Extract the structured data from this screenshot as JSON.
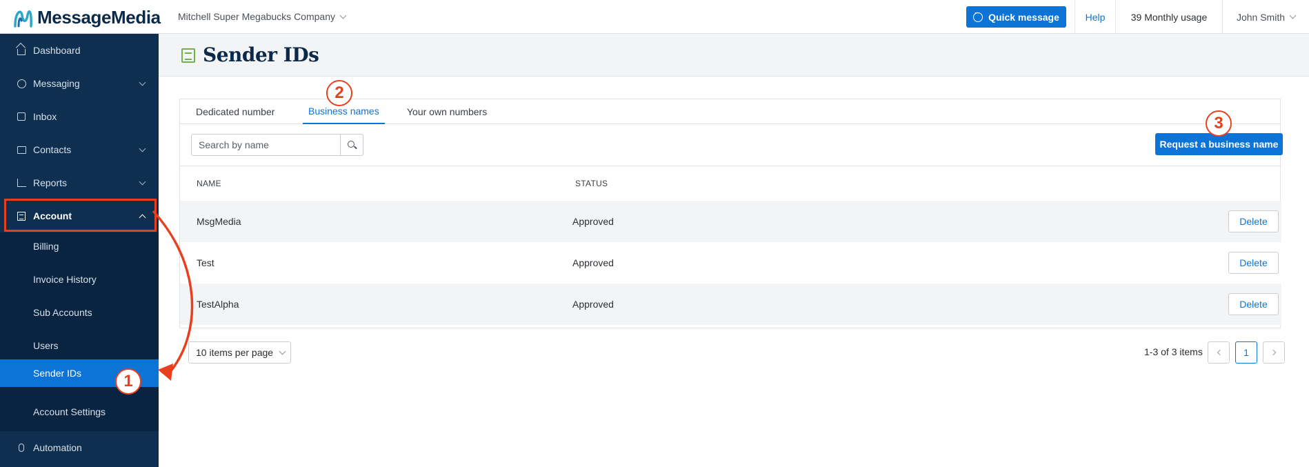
{
  "brand": {
    "name": "MessageMedia",
    "logo_icon": "messagemedia-logo-icon"
  },
  "header": {
    "company": "Mitchell Super Megabucks Company",
    "quick_message": "Quick message",
    "help": "Help",
    "usage": "39 Monthly usage",
    "user": "John Smith"
  },
  "sidebar": {
    "items": [
      {
        "label": "Dashboard",
        "icon": "home-icon"
      },
      {
        "label": "Messaging",
        "icon": "chat-bubble-icon"
      },
      {
        "label": "Inbox",
        "icon": "inbox-icon"
      },
      {
        "label": "Contacts",
        "icon": "contacts-icon"
      },
      {
        "label": "Reports",
        "icon": "chart-icon"
      },
      {
        "label": "Account",
        "icon": "account-icon"
      },
      {
        "label": "Automation",
        "icon": "automation-icon"
      }
    ],
    "account_submenu": [
      "Billing",
      "Invoice History",
      "Sub Accounts",
      "Users",
      "Sender IDs",
      "Account Settings"
    ]
  },
  "page": {
    "title": "Sender IDs"
  },
  "tabs": [
    "Dedicated number",
    "Business names",
    "Your own numbers"
  ],
  "search": {
    "placeholder": "Search by name"
  },
  "request_button": "Request a business name",
  "table": {
    "columns": [
      "NAME",
      "STATUS"
    ],
    "rows": [
      {
        "name": "MsgMedia",
        "status": "Approved",
        "action": "Delete"
      },
      {
        "name": "Test",
        "status": "Approved",
        "action": "Delete"
      },
      {
        "name": "TestAlpha",
        "status": "Approved",
        "action": "Delete"
      }
    ]
  },
  "pagination": {
    "per_page": "10 items per page",
    "range": "1-3 of 3 items",
    "current_page": "1"
  },
  "annotations": {
    "step1": "1",
    "step2": "2",
    "step3": "3"
  },
  "colors": {
    "primary": "#0b74d6",
    "sidebar": "#0f2f50",
    "annotation": "#e8401f",
    "title_icon": "#6fb24a"
  }
}
